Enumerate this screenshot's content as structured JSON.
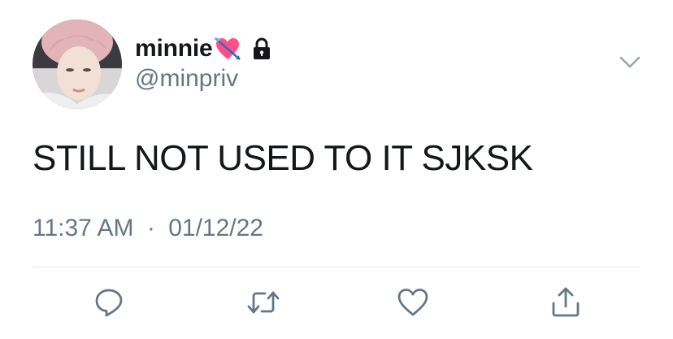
{
  "user": {
    "display_name": "minnie",
    "handle": "@minpriv",
    "name_emoji": "heart-with-arrow-emoji",
    "protected_icon": "lock-icon",
    "avatar": "profile-photo"
  },
  "tweet": {
    "text": "STILL NOT USED TO IT SJKSK",
    "time": "11:37 AM",
    "separator": "·",
    "date": "01/12/22"
  },
  "actions": [
    {
      "name": "reply",
      "icon": "speech-bubble-icon"
    },
    {
      "name": "retweet",
      "icon": "retweet-icon"
    },
    {
      "name": "like",
      "icon": "heart-icon"
    },
    {
      "name": "share",
      "icon": "share-icon"
    }
  ],
  "colors": {
    "text_primary": "#14171a",
    "text_secondary": "#657786",
    "icon": "#657786",
    "divider": "#e1e8ed",
    "emoji_heart": "#ff4f8b"
  }
}
